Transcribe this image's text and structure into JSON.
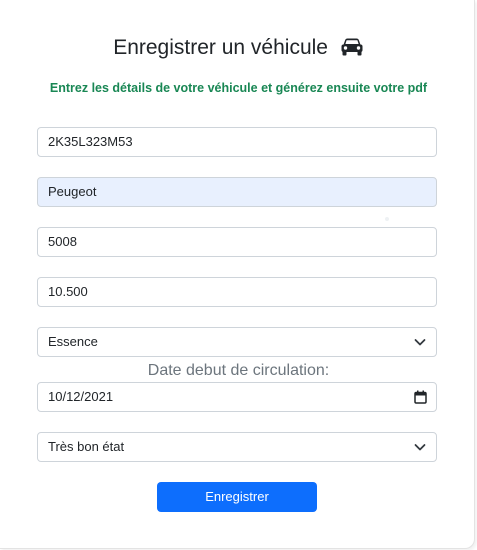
{
  "form": {
    "title": "Enregistrer un véhicule",
    "title_icon": "car-icon",
    "subtitle": "Entrez les détails de votre véhicule et générez ensuite votre pdf",
    "fields": {
      "immatriculation": "2K35L323M53",
      "marque": "Peugeot",
      "modele": "5008",
      "kilometrage": "10.500",
      "carburant": "Essence",
      "date_label": "Date debut de circulation:",
      "date": "10/12/2021",
      "etat": "Très bon état"
    },
    "submit_label": "Enregistrer"
  },
  "colors": {
    "accent": "#0d6efd",
    "subtitle_green": "#198754",
    "autofill_bg": "#e8f0fe",
    "border": "#ced4da"
  }
}
